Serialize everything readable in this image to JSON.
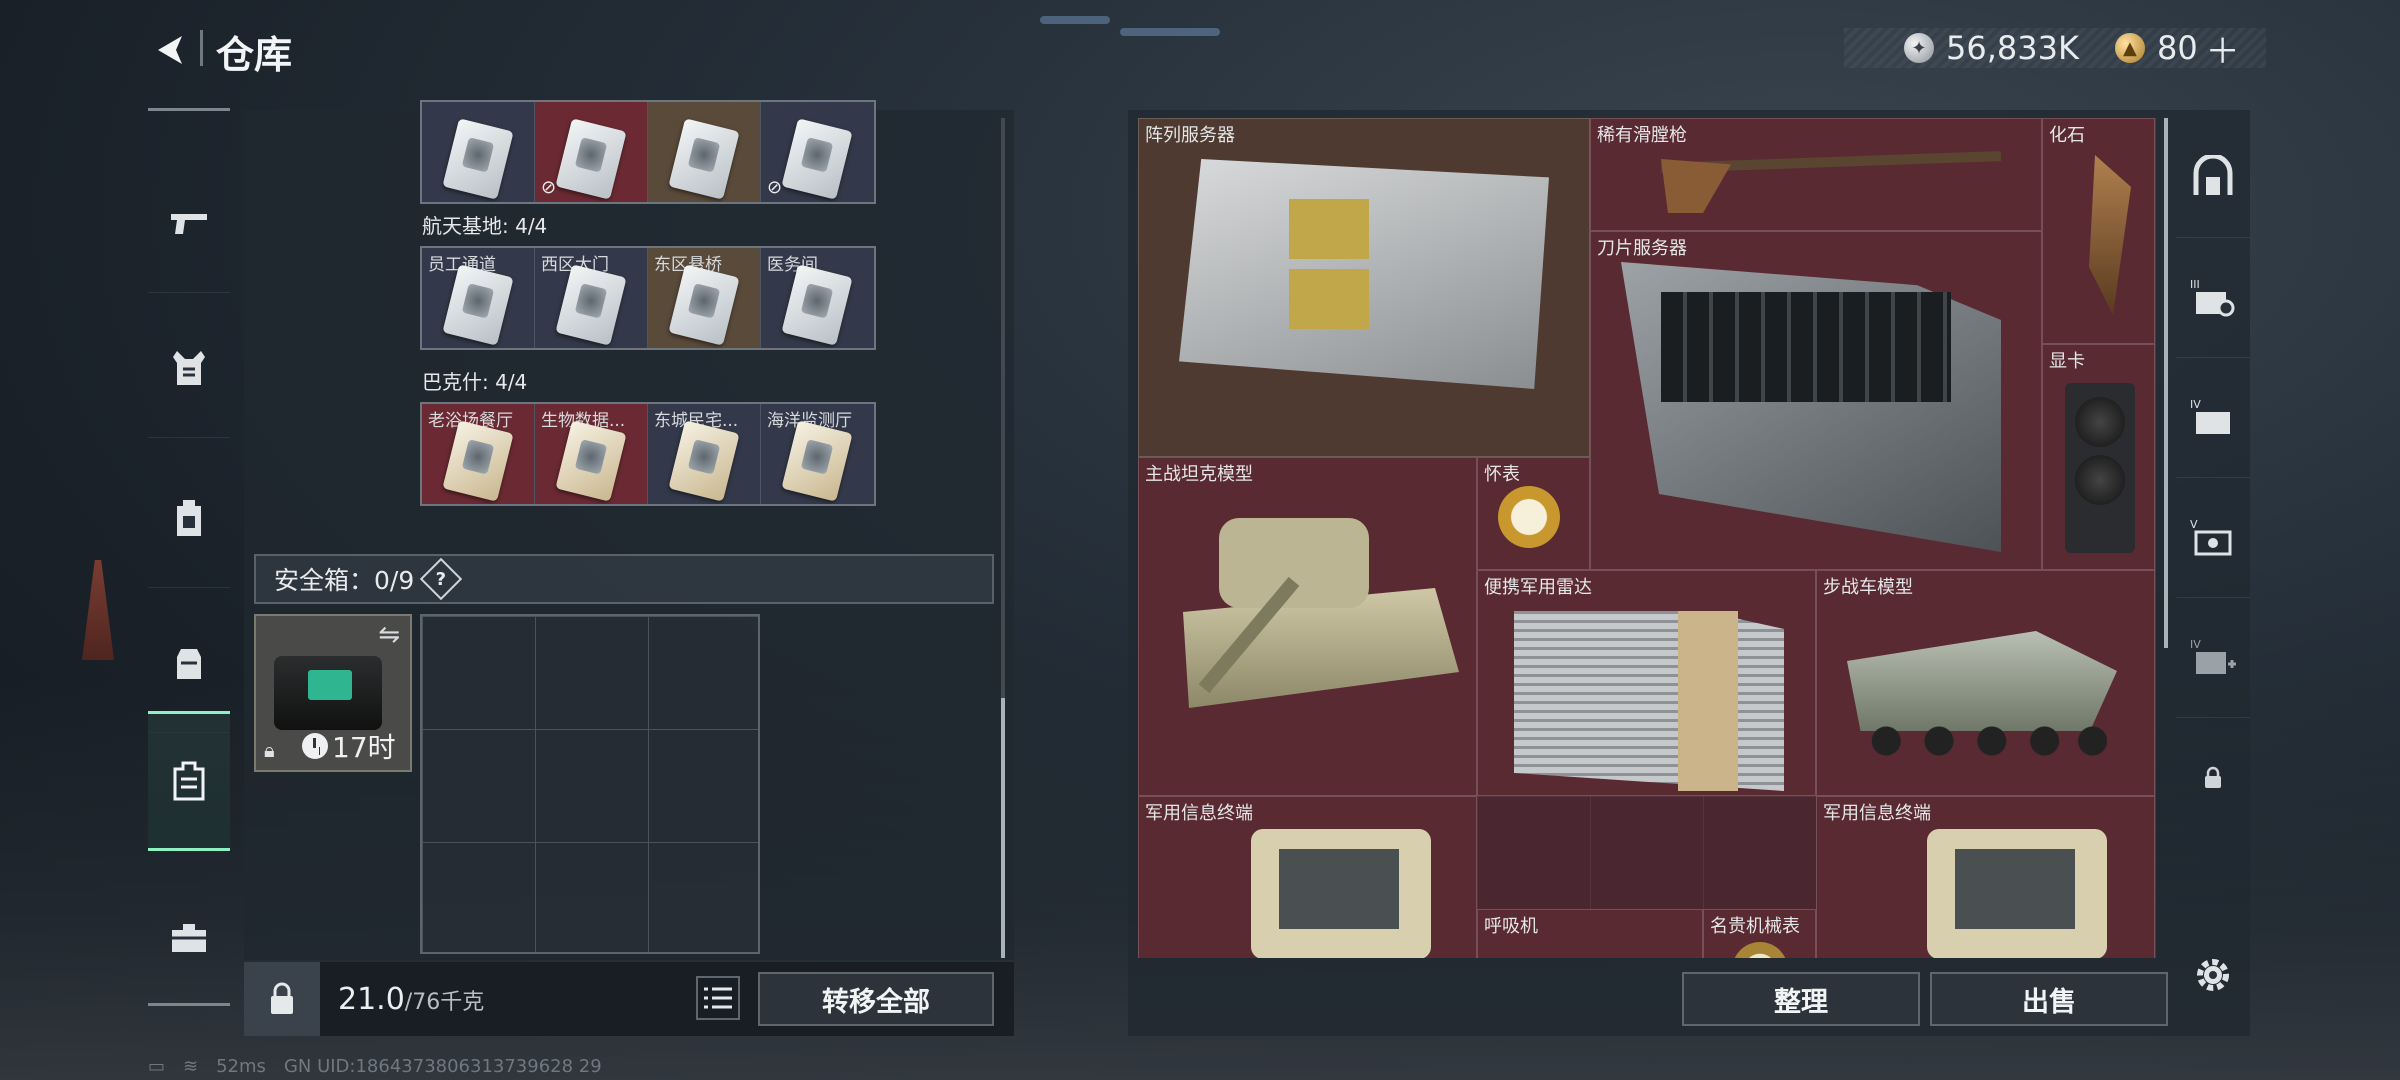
{
  "header": {
    "title": "仓库",
    "silver": "56,833K",
    "gold": "80"
  },
  "left_panel": {
    "top_row": [
      {
        "name": "",
        "tone": "slate",
        "locked": false
      },
      {
        "name": "",
        "tone": "red",
        "locked": true
      },
      {
        "name": "",
        "tone": "brown",
        "locked": false
      },
      {
        "name": "",
        "tone": "slate",
        "locked": true
      }
    ],
    "groups": [
      {
        "label": "航天基地: 4/4",
        "cards": [
          {
            "name": "员工通道",
            "tone": "slate"
          },
          {
            "name": "西区大门",
            "tone": "slate"
          },
          {
            "name": "东区悬桥",
            "tone": "brown"
          },
          {
            "name": "医务间",
            "tone": "slate"
          }
        ]
      },
      {
        "label": "巴克什: 4/4",
        "cards": [
          {
            "name": "老浴场餐厅",
            "tone": "red"
          },
          {
            "name": "生物数据...",
            "tone": "red"
          },
          {
            "name": "东城民宅...",
            "tone": "slate"
          },
          {
            "name": "海洋监测厅",
            "tone": "slate"
          }
        ]
      }
    ],
    "safe_label": "安全箱：0/9",
    "safe_help": "?",
    "safebox_timer": "17时",
    "weight_value": "21.0",
    "weight_max": "/76千克",
    "transfer_all": "转移全部"
  },
  "stash_items": [
    {
      "name": "阵列服务器"
    },
    {
      "name": "稀有滑膛枪"
    },
    {
      "name": "化石"
    },
    {
      "name": "刀片服务器"
    },
    {
      "name": "显卡"
    },
    {
      "name": "主战坦克模型"
    },
    {
      "name": "怀表"
    },
    {
      "name": "便携军用雷达"
    },
    {
      "name": "步战车模型"
    },
    {
      "name": "军用信息终端"
    },
    {
      "name": "军用信息终端"
    },
    {
      "name": "呼吸机"
    },
    {
      "name": "名贵机械表"
    }
  ],
  "right_panel": {
    "organize": "整理",
    "sell": "出售"
  },
  "status": {
    "ping": "52ms",
    "uid": "GN UID:1864373806313739628 29"
  },
  "colors": {
    "accent": "#8ff0c4",
    "red_rarity": "#5a2a33",
    "brown_rarity": "#4e3a30"
  }
}
